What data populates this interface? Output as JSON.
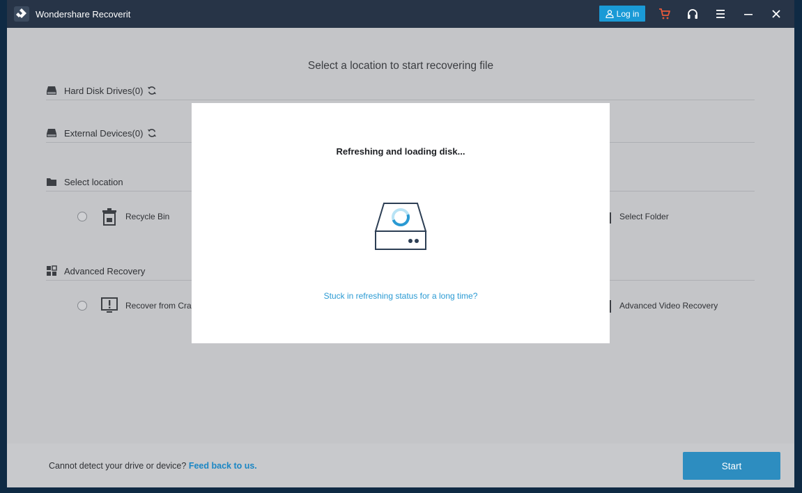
{
  "app": {
    "title": "Wondershare Recoverit",
    "login_label": "Log in"
  },
  "colors": {
    "titlebar": "#273447",
    "accent": "#1a9ad6",
    "cart": "#e8593a",
    "link": "#2a9ad3"
  },
  "icons": {
    "cart": "cart-icon",
    "support": "headset-icon",
    "menu": "menu-icon",
    "minimize": "minimize-icon",
    "close": "close-icon"
  },
  "main": {
    "heading": "Select a location to start recovering file",
    "sections": {
      "hard_disk": "Hard Disk Drives(0)",
      "external": "External Devices(0)",
      "select_location": "Select location",
      "advanced": "Advanced Recovery"
    },
    "options": {
      "recycle_bin": "Recycle Bin",
      "select_folder": "Select Folder",
      "recover_crash": "Recover from Crash",
      "advanced_video": "Advanced Video Recovery"
    }
  },
  "modal": {
    "title": "Refreshing and loading disk...",
    "link": "Stuck in refreshing status for a long time?"
  },
  "footer": {
    "text": "Cannot detect your drive or device?",
    "link": "Feed back to us.",
    "start_label": "Start"
  }
}
